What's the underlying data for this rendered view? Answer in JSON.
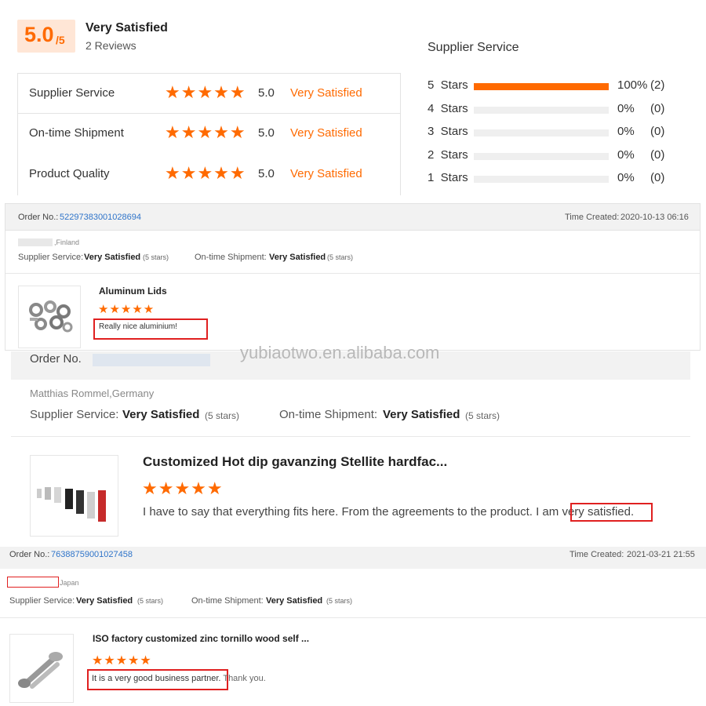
{
  "summary": {
    "score": "5.0",
    "score_out_of": "/5",
    "label": "Very Satisfied",
    "reviews": "2 Reviews"
  },
  "ratings": [
    {
      "label": "Supplier Service",
      "value": "5.0",
      "text": "Very Satisfied",
      "stars": 5
    },
    {
      "label": "On-time Shipment",
      "value": "5.0",
      "text": "Very Satisfied",
      "stars": 5
    },
    {
      "label": "Product Quality",
      "value": "5.0",
      "text": "Very Satisfied",
      "stars": 5
    }
  ],
  "breakdown": {
    "title": "Supplier Service",
    "rows": [
      {
        "label": "5  Stars",
        "fraction": 1.0,
        "pct": "100%",
        "count": "(2)"
      },
      {
        "label": "4  Stars",
        "fraction": 0.0,
        "pct": "0%",
        "count": "(0)"
      },
      {
        "label": "3  Stars",
        "fraction": 0.0,
        "pct": "0%",
        "count": "(0)"
      },
      {
        "label": "2  Stars",
        "fraction": 0.0,
        "pct": "0%",
        "count": "(0)"
      },
      {
        "label": "1  Stars",
        "fraction": 0.0,
        "pct": "0%",
        "count": "(0)"
      }
    ]
  },
  "order1": {
    "order_label": "Order No.:",
    "order_no": "52297383001028694",
    "time_label": "Time Created:",
    "time": "2020-10-13 06:16",
    "buyer": ",Finland",
    "svc_label": "Supplier Service:",
    "svc_value": "Very Satisfied",
    "svc_stars": "(5 stars)",
    "ship_label": "On-time Shipment:",
    "ship_value": "Very Satisfied",
    "ship_stars": "(5 stars)",
    "product": "Aluminum Lids",
    "comment": "Really nice aluminium!"
  },
  "watermark": "yubiaotwo.en.alibaba.com",
  "order2": {
    "order_label": "Order No.",
    "buyer": "Matthias Rommel,Germany",
    "svc_label": "Supplier Service:",
    "svc_value": "Very Satisfied",
    "svc_stars": "(5 stars)",
    "ship_label": "On-time Shipment:",
    "ship_value": "Very Satisfied",
    "ship_stars": "(5 stars)",
    "product": "Customized Hot dip gavanzing Stellite hardfac...",
    "comment_start": "I have to say that everything fits here. From the agreements to the product. I am ",
    "comment_highlight": "very satisfied."
  },
  "order3": {
    "order_label": "Order No.:",
    "order_no": "76388759001027458",
    "time_label": "Time Created:",
    "time": "2021-03-21 21:55",
    "buyer": "Japan",
    "svc_label": "Supplier Service:",
    "svc_value": "Very Satisfied",
    "svc_stars": "(5 stars)",
    "ship_label": "On-time Shipment:",
    "ship_value": "Very Satisfied",
    "ship_stars": "(5 stars)",
    "product": "ISO factory customized zinc tornillo wood self ...",
    "comment_highlight": "It is a very good business partner.",
    "comment_end": "Thank you."
  },
  "star_glyphs": "★★★★★",
  "accent_color": "#ff6a00",
  "link_color": "#2f74c9",
  "highlight_color": "#e02020"
}
